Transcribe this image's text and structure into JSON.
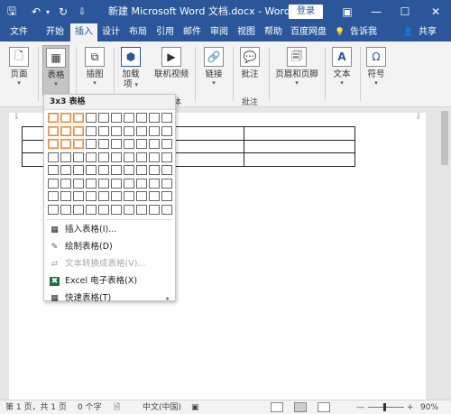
{
  "titlebar": {
    "title": "新建 Microsoft Word 文档.docx  -  Word",
    "login_label": "登录",
    "save_glyph": "🖫",
    "undo_glyph": "↶",
    "undo_caret": "▾",
    "redo_glyph": "↻",
    "customize_glyph": "⇩",
    "ribbon_options_glyph": "▣",
    "minimize_glyph": "—",
    "maximize_glyph": "☐",
    "close_glyph": "✕"
  },
  "tabs": [
    {
      "label": "文件"
    },
    {
      "label": "开始"
    },
    {
      "label": "插入",
      "active": true
    },
    {
      "label": "设计"
    },
    {
      "label": "布局"
    },
    {
      "label": "引用"
    },
    {
      "label": "邮件"
    },
    {
      "label": "审阅"
    },
    {
      "label": "视图"
    },
    {
      "label": "帮助"
    },
    {
      "label": "百度网盘"
    },
    {
      "label": "告诉我"
    },
    {
      "label": "共享"
    }
  ],
  "tab_icons": {
    "tell_me": "💡",
    "share": "👤"
  },
  "ribbon": {
    "page": {
      "label": "页面",
      "caret": "▾",
      "icon_glyph": "🗋"
    },
    "table": {
      "label": "表格",
      "caret": "▾",
      "icon_glyph": "▦"
    },
    "illustrations": {
      "label": "插图",
      "caret": "▾",
      "icon_glyph": "⧉"
    },
    "addins": {
      "label": "加载",
      "label2": "项",
      "caret": "▾",
      "icon_glyph": "⬢"
    },
    "online_video": {
      "label": "联机视频",
      "icon_glyph": "▶"
    },
    "link": {
      "label": "链接",
      "caret": "▾",
      "icon_glyph": "🔗"
    },
    "comment": {
      "label": "批注",
      "icon_glyph": "💬"
    },
    "header_footer": {
      "label": "页眉和页脚",
      "caret": "▾",
      "icon_glyph": "🗐"
    },
    "text": {
      "label": "文本",
      "caret": "▾",
      "icon_glyph": "A"
    },
    "symbols": {
      "label": "符号",
      "caret": "▾",
      "icon_glyph": "Ω"
    },
    "group_media_fragment": "体",
    "group_comments_label": "批注"
  },
  "table_dropdown": {
    "header": "3x3 表格",
    "grid": {
      "columns": 10,
      "rows": 8,
      "selected_columns": 3,
      "selected_rows": 3
    },
    "items": [
      {
        "label": "插入表格(I)...",
        "icon_glyph": "▦",
        "disabled": false
      },
      {
        "label": "绘制表格(D)",
        "icon_glyph": "✎",
        "disabled": false
      },
      {
        "label": "文本转换成表格(V)...",
        "icon_glyph": "⇄",
        "disabled": true
      },
      {
        "label": "Excel 电子表格(X)",
        "icon_glyph": "✖",
        "disabled": false
      },
      {
        "label": "快速表格(T)",
        "icon_glyph": "▦",
        "disabled": false,
        "submenu": true
      }
    ],
    "submenu_arrow": "▸"
  },
  "document_table": {
    "rows": 3,
    "columns": 3
  },
  "statusbar": {
    "page": "第 1 页，共 1 页",
    "words": "0 个字",
    "language": "中文(中国)",
    "zoom_minus": "—",
    "zoom_plus": "+",
    "zoom": "90%",
    "proofing_glyph": "🗎",
    "macro_glyph": "▣"
  },
  "colors": {
    "brand_blue": "#2b579a",
    "selection_orange": "#f0883a"
  }
}
